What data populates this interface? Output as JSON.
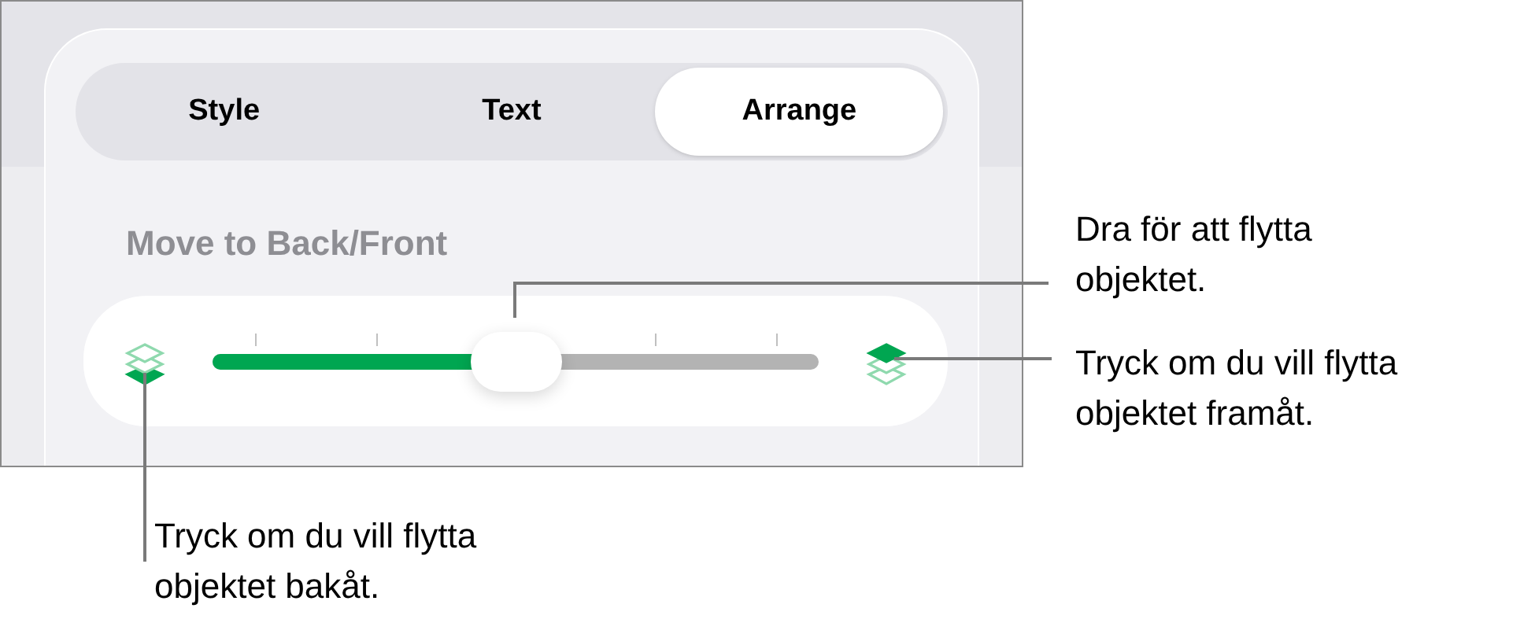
{
  "tabs": [
    {
      "label": "Style",
      "selected": false
    },
    {
      "label": "Text",
      "selected": false
    },
    {
      "label": "Arrange",
      "selected": true
    }
  ],
  "section_label": "Move to Back/Front",
  "slider": {
    "level": 0.5
  },
  "callouts": [
    {
      "text": "Dra för att flytta objektet."
    },
    {
      "text": "Tryck om du vill flytta objektet framåt."
    },
    {
      "text": "Tryck om du vill flytta objektet bakåt."
    }
  ]
}
